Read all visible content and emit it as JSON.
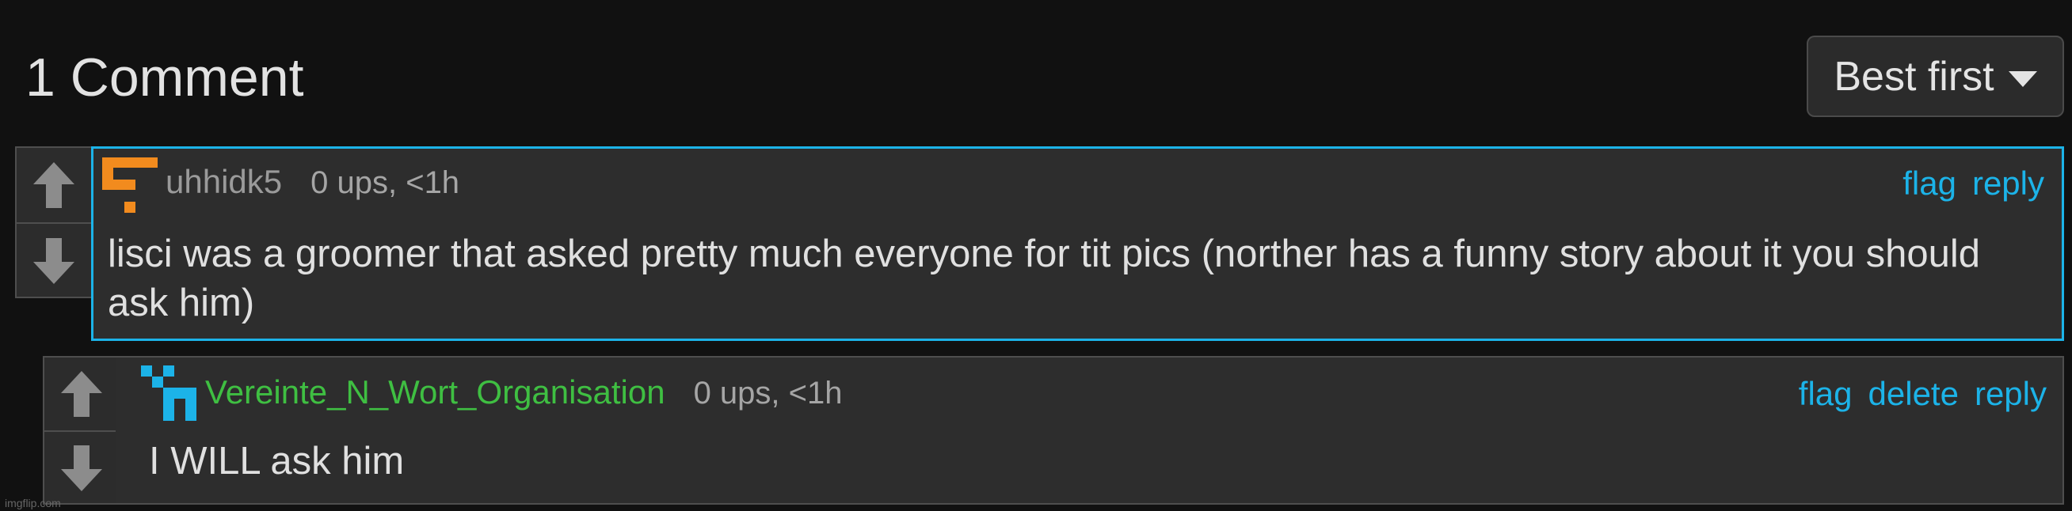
{
  "header": {
    "title": "1 Comment",
    "sort_label": "Best first"
  },
  "comments": [
    {
      "username": "uhhidk5",
      "stats": "0 ups, <1h",
      "actions": [
        "flag",
        "reply"
      ],
      "text": "lisci was a groomer that asked pretty much everyone for tit pics (norther has a funny story about it you should ask him)",
      "avatar_icon": "pixel-avatar-orange-icon",
      "avatar_color": "#f28b1e"
    },
    {
      "username": "Vereinte_N_Wort_Organisation",
      "stats": "0 ups, <1h",
      "actions": [
        "flag",
        "delete",
        "reply"
      ],
      "text": "I WILL ask him",
      "avatar_icon": "pixel-avatar-blue-icon",
      "avatar_color": "#1cb3e8",
      "username_color": "#3fbf42"
    }
  ],
  "watermark": "imgflip.com",
  "colors": {
    "accent": "#1cb3e8",
    "background": "#111111",
    "panel": "#2d2d2d"
  }
}
